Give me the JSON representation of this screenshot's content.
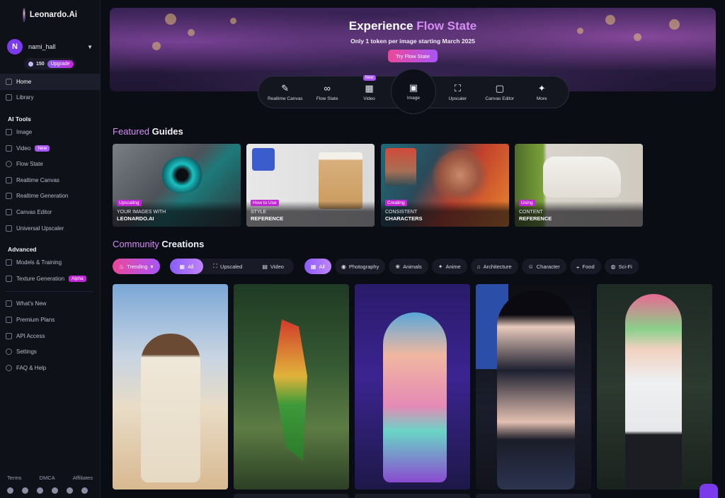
{
  "app": {
    "brand": "Leonardo.Ai"
  },
  "user": {
    "initial": "N",
    "name": "nami_hall",
    "tokens": "150",
    "upgrade": "Upgrade"
  },
  "sidebar": {
    "top": [
      {
        "label": "Home",
        "icon": "home-icon"
      },
      {
        "label": "Library",
        "icon": "library-icon"
      }
    ],
    "ai_tools_title": "AI Tools",
    "ai_tools": [
      {
        "label": "Image",
        "icon": "image-icon"
      },
      {
        "label": "Video",
        "icon": "video-icon",
        "badge": "New"
      },
      {
        "label": "Flow State",
        "icon": "infinity-icon"
      },
      {
        "label": "Realtime Canvas",
        "icon": "brush-icon"
      },
      {
        "label": "Realtime Generation",
        "icon": "bolt-icon"
      },
      {
        "label": "Canvas Editor",
        "icon": "canvas-icon"
      },
      {
        "label": "Universal Upscaler",
        "icon": "upscale-icon"
      }
    ],
    "advanced_title": "Advanced",
    "advanced": [
      {
        "label": "Models & Training",
        "icon": "models-icon"
      },
      {
        "label": "Texture Generation",
        "icon": "texture-icon",
        "badge": "Alpha"
      }
    ],
    "bottom": [
      {
        "label": "What's New",
        "icon": "megaphone-icon"
      },
      {
        "label": "Premium Plans",
        "icon": "crown-icon"
      },
      {
        "label": "API Access",
        "icon": "api-icon"
      },
      {
        "label": "Settings",
        "icon": "gear-icon"
      },
      {
        "label": "FAQ & Help",
        "icon": "help-icon"
      }
    ],
    "footer": {
      "terms": "Terms",
      "dmca": "DMCA",
      "affiliates": "Affiliates"
    },
    "socials": [
      "discord-icon",
      "reddit-icon",
      "x-icon",
      "facebook-icon",
      "apple-icon",
      "playstore-icon"
    ]
  },
  "hero": {
    "title_a": "Experience ",
    "title_b": "Flow State",
    "subtitle": "Only 1 token per image starting March 2025",
    "button": "Try Flow State"
  },
  "tools": [
    {
      "label": "Realtime Canvas",
      "glyph": "✎",
      "icon": "realtime-canvas-icon"
    },
    {
      "label": "Flow State",
      "glyph": "∞",
      "icon": "infinity-icon"
    },
    {
      "label": "Video",
      "glyph": "▦",
      "icon": "film-icon",
      "badge": "New"
    },
    {
      "label": "Image",
      "glyph": "▣",
      "icon": "image-icon"
    },
    {
      "label": "Upscaler",
      "glyph": "⛶",
      "icon": "upscaler-icon"
    },
    {
      "label": "Canvas Editor",
      "glyph": "▢",
      "icon": "canvas-editor-icon"
    },
    {
      "label": "More",
      "glyph": "✦",
      "icon": "sparkle-icon"
    }
  ],
  "featured": {
    "title_a": "Featured",
    "title_b": " Guides",
    "cards": [
      {
        "tag": "Upscaling",
        "line1": "YOUR IMAGES WITH",
        "line2": "LEONARDO.AI"
      },
      {
        "tag": "How to Use",
        "line1": "STYLE",
        "line2": "REFERENCE"
      },
      {
        "tag": "Creating",
        "line1": "CONSISTENT",
        "line2": "CHARACTERS"
      },
      {
        "tag": "Using",
        "line1": "CONTENT",
        "line2": "REFERENCE"
      }
    ]
  },
  "community": {
    "title_a": "Community",
    "title_b": " Creations",
    "sort": "Trending",
    "media_filters": [
      "All",
      "Upscaled",
      "Video"
    ],
    "categories": [
      "All",
      "Photography",
      "Animals",
      "Anime",
      "Architecture",
      "Character",
      "Food",
      "Sci-Fi"
    ]
  }
}
